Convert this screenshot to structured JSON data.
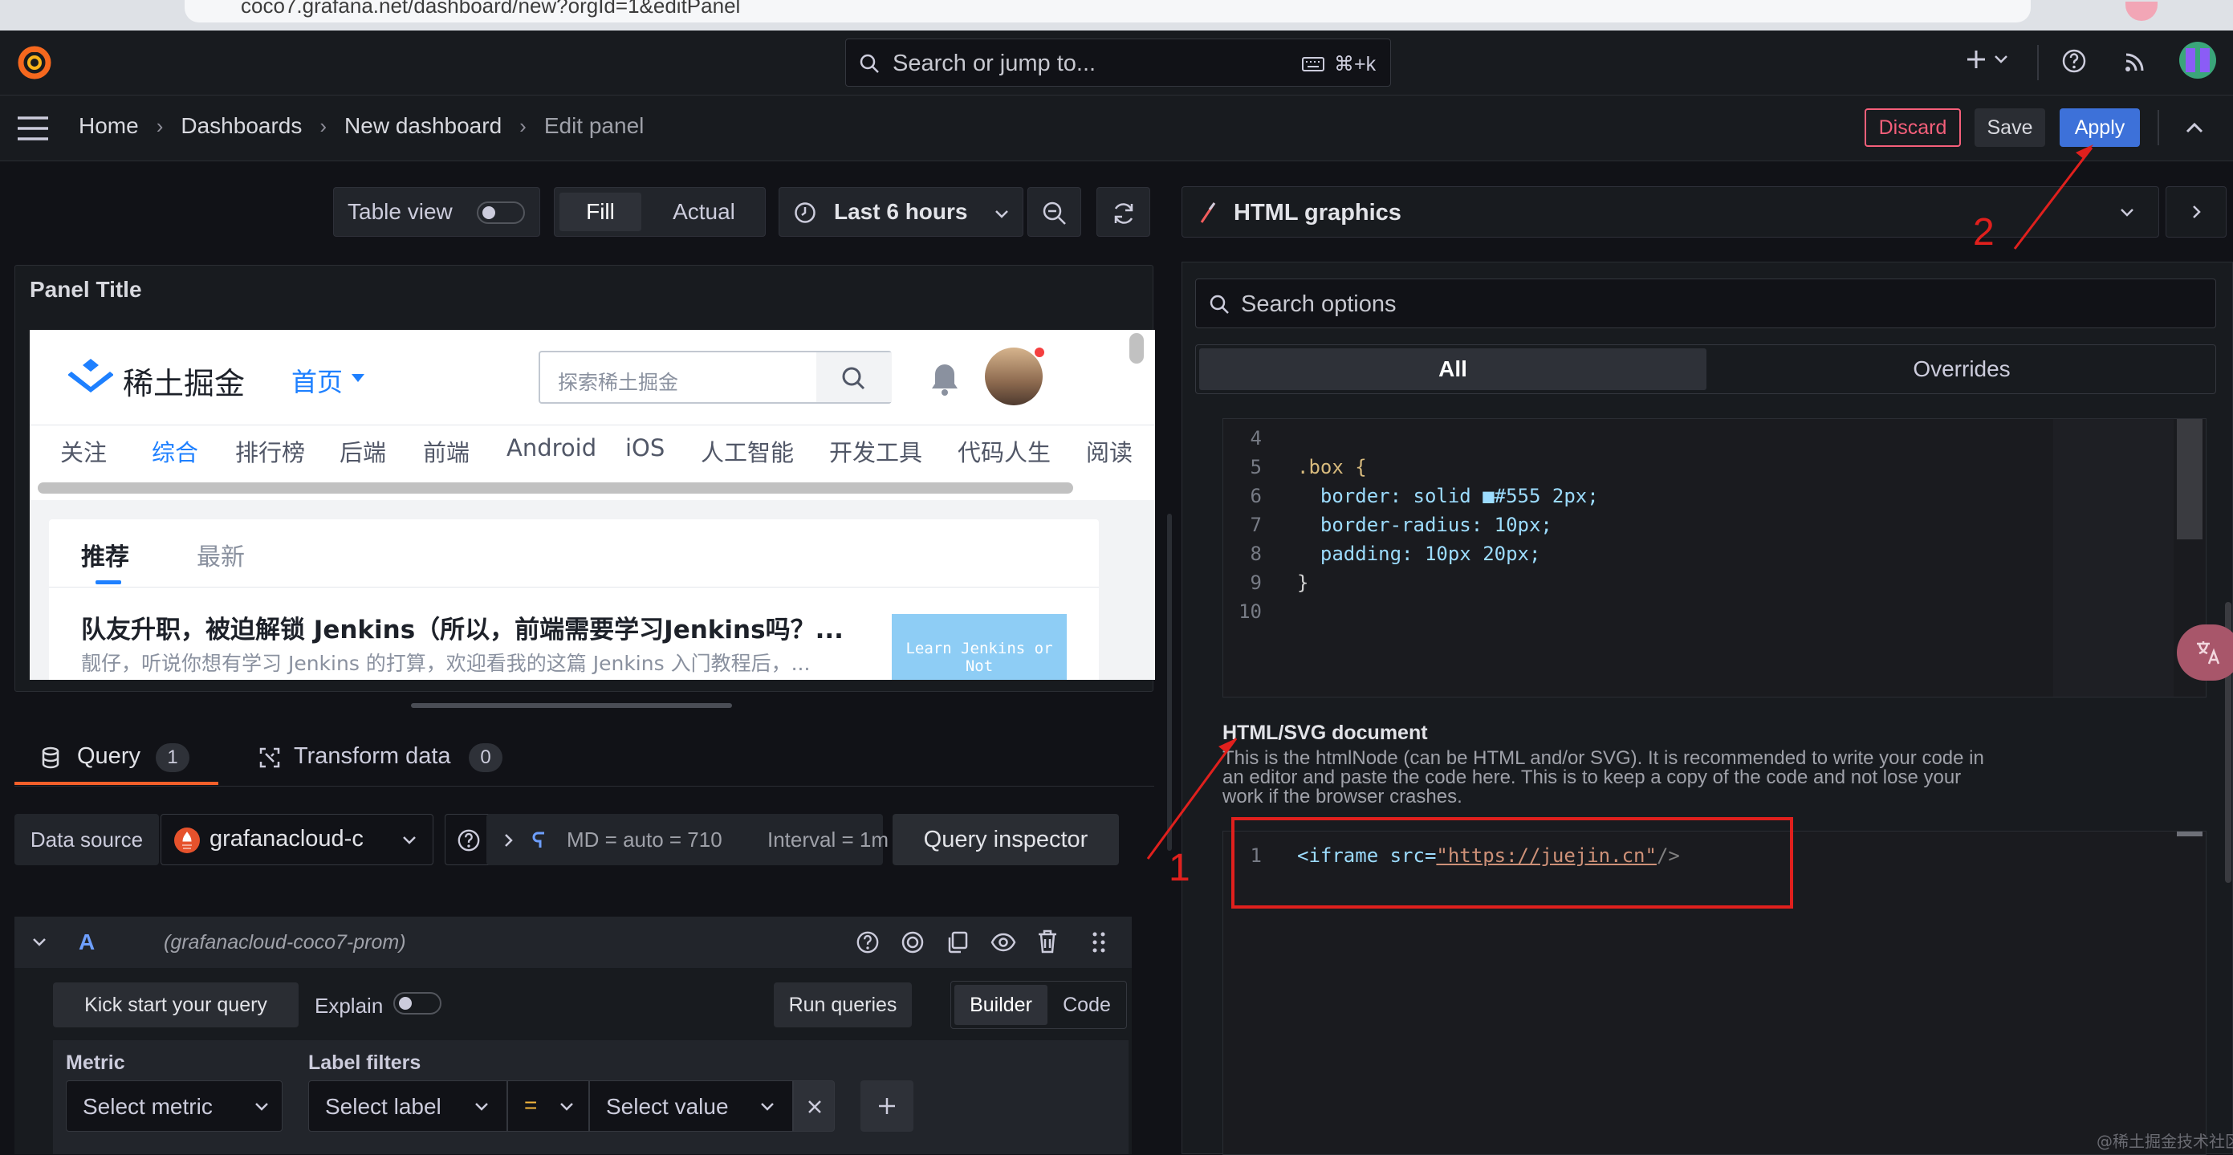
{
  "browser": {
    "url": "coco7.grafana.net/dashboard/new?orgId=1&editPanel"
  },
  "topnav": {
    "search_placeholder": "Search or jump to...",
    "shortcut": "⌘+k"
  },
  "breadcrumb": {
    "items": [
      "Home",
      "Dashboards",
      "New dashboard",
      "Edit panel"
    ]
  },
  "actions": {
    "discard": "Discard",
    "save": "Save",
    "apply": "Apply"
  },
  "toolbar": {
    "table_view": "Table view",
    "fill": "Fill",
    "actual": "Actual",
    "time_range": "Last 6 hours"
  },
  "panel": {
    "title": "Panel Title"
  },
  "juejin": {
    "logo_text": "稀土掘金",
    "home_menu": "首页",
    "search_placeholder": "探索稀土掘金",
    "categories": [
      "关注",
      "综合",
      "排行榜",
      "后端",
      "前端",
      "Android",
      "iOS",
      "人工智能",
      "开发工具",
      "代码人生",
      "阅读"
    ],
    "feed_tabs": [
      "推荐",
      "最新"
    ],
    "article_title": "队友升职，被迫解锁 Jenkins（所以，前端需要学习Jenkins吗？...",
    "article_excerpt": "靓仔，听说你想有学习 Jenkins 的打算，欢迎看我的这篇 Jenkins 入门教程后，...",
    "article_thumb": "Learn Jenkins or Not"
  },
  "query_tabs": [
    {
      "label": "Query",
      "count": "1"
    },
    {
      "label": "Transform data",
      "count": "0"
    }
  ],
  "query_row": {
    "datasource_label": "Data source",
    "datasource": "grafanacloud-c",
    "options": "MD = auto = 710",
    "interval": "Interval = 1m",
    "inspector": "Query inspector"
  },
  "query_a": {
    "letter": "A",
    "source": "(grafanacloud-coco7-prom)",
    "kickstart": "Kick start your query",
    "explain": "Explain",
    "run": "Run queries",
    "builder": "Builder",
    "code": "Code",
    "metric_label": "Metric",
    "label_filters_label": "Label filters",
    "metric_placeholder": "Select metric",
    "label_placeholder": "Select label",
    "operator": "=",
    "value_placeholder": "Select value"
  },
  "viz": {
    "name": "HTML graphics"
  },
  "options": {
    "search_placeholder": "Search options",
    "tabs": [
      "All",
      "Overrides"
    ]
  },
  "css_editor": {
    "lines": [
      {
        "n": "4",
        "text": ""
      },
      {
        "n": "5",
        "text": ".box {"
      },
      {
        "n": "6",
        "text": "  border: solid ■#555 2px;"
      },
      {
        "n": "7",
        "text": "  border-radius: 10px;"
      },
      {
        "n": "8",
        "text": "  padding: 10px 20px;"
      },
      {
        "n": "9",
        "text": "}"
      },
      {
        "n": "10",
        "text": ""
      }
    ]
  },
  "html_doc": {
    "title": "HTML/SVG document",
    "description": "This is the htmlNode (can be HTML and/or SVG). It is recommended to write your code in an editor and paste the code here. This is to keep a copy of the code and not lose your work if the browser crashes.",
    "line_number": "1",
    "code_open": "<iframe src=",
    "code_url": "\"https://juejin.cn\"",
    "code_close": "/>"
  },
  "annotations": {
    "one": "1",
    "two": "2"
  },
  "watermark": "@稀土掘金技术社区",
  "colors": {
    "accent": "#3d71d9",
    "discard": "#f55f7a",
    "annotation": "#e0201d",
    "bg": "#111217",
    "panel": "#181b1f"
  }
}
